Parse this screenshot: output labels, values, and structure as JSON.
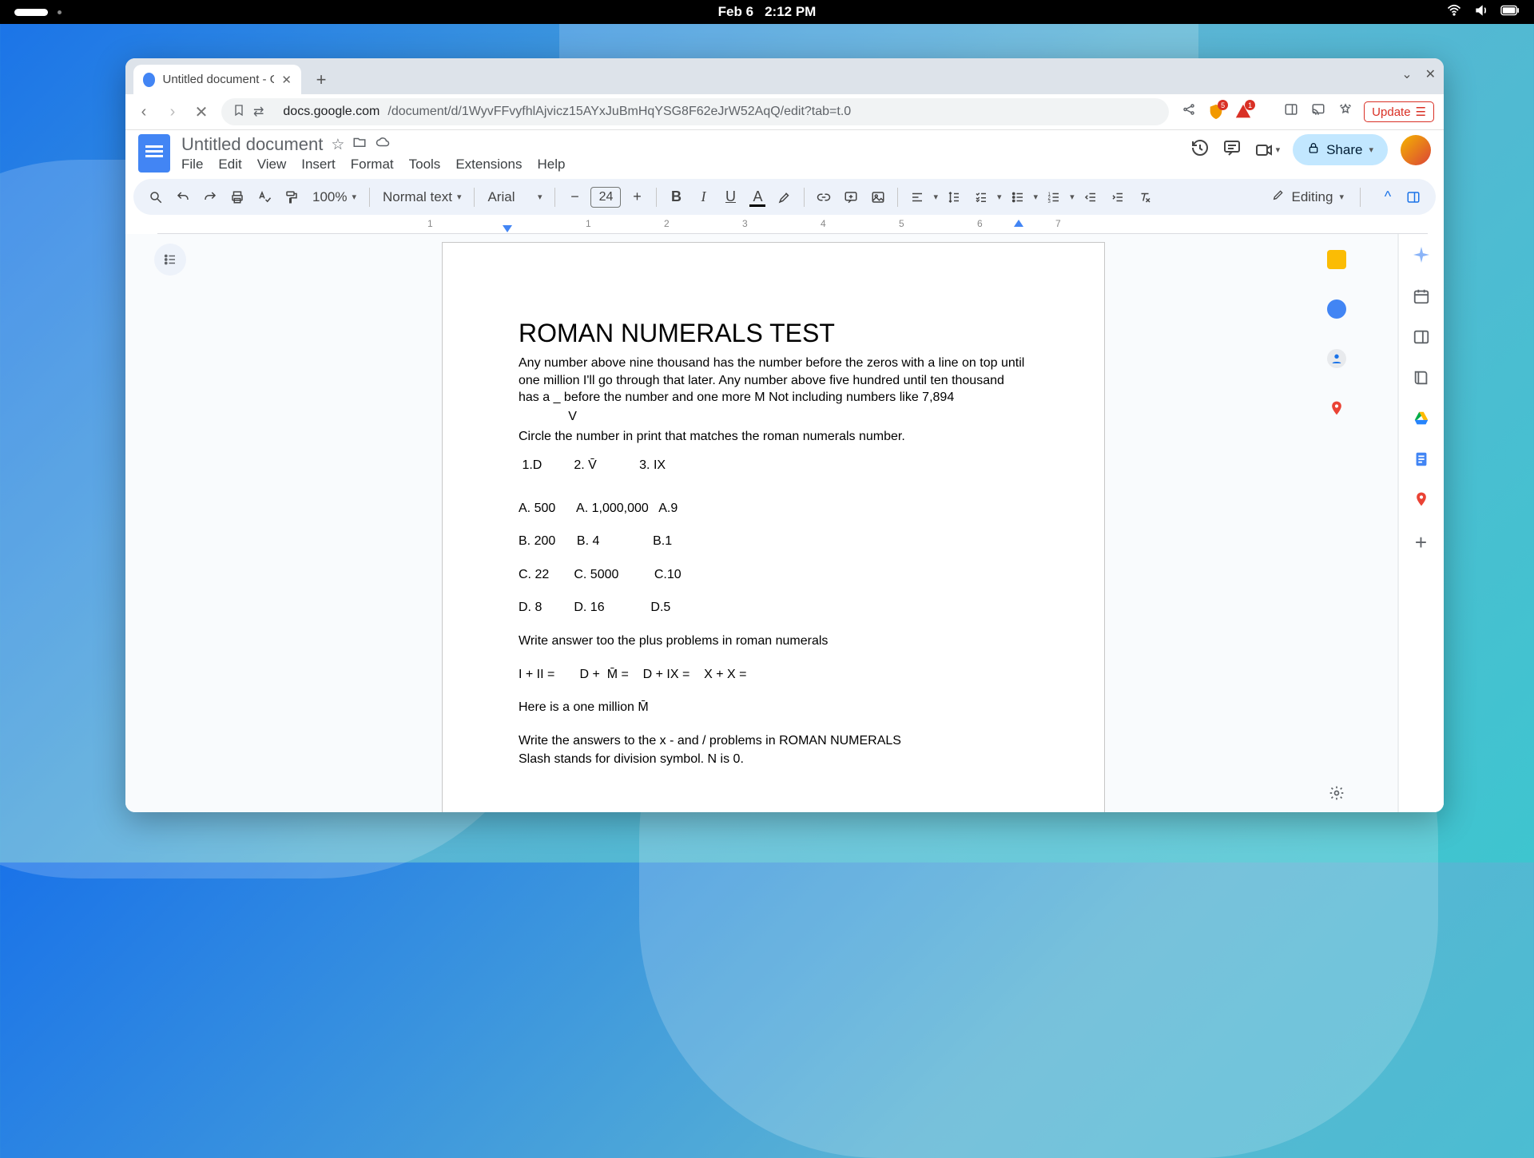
{
  "mac": {
    "date": "Feb 6",
    "time": "2:12 PM"
  },
  "browser": {
    "tab_title": "Untitled document - Goo",
    "url_host": "docs.google.com",
    "url_path": "/document/d/1WyvFFvyfhlAjvicz15AYxJuBmHqYSG8F62eJrW52AqQ/edit?tab=t.0",
    "update_label": "Update"
  },
  "docs": {
    "title": "Untitled document",
    "menus": [
      "File",
      "Edit",
      "View",
      "Insert",
      "Format",
      "Tools",
      "Extensions",
      "Help"
    ],
    "share_label": "Share",
    "toolbar": {
      "zoom": "100%",
      "style": "Normal text",
      "font": "Arial",
      "font_size": "24",
      "mode": "Editing"
    },
    "ruler_nums": [
      "1",
      "1",
      "2",
      "3",
      "4",
      "5",
      "6",
      "7"
    ]
  },
  "document": {
    "title": "ROMAN NUMERALS TEST",
    "para1": "Any number above nine thousand has the number before the zeros with a line on top until one million I'll go through that later. Any number above five hundred until ten thousand has a _  before the number and one more M Not including numbers like 7,894",
    "para1b_indent": "              V",
    "para2": "Circle the number in print that matches the roman numerals number.",
    "q_row": " 1.D         2. V̄            3. IX",
    "a_row": "A. 500      A. 1,000,000   A.9",
    "b_row": "B. 200      B. 4               B.1",
    "c_row": "C. 22       C. 5000          C.10",
    "d_row": "D. 8         D. 16             D.5",
    "para3": "Write answer  too the plus problems in roman numerals",
    "eq_row": "I + II =       D +  M̄ =    D + IX =    X + X =",
    "para4": "Here is a one million M̄",
    "para5": "Write the answers to the x - and / problems in ROMAN NUMERALS",
    "para6": "Slash stands for division symbol. N is 0."
  }
}
